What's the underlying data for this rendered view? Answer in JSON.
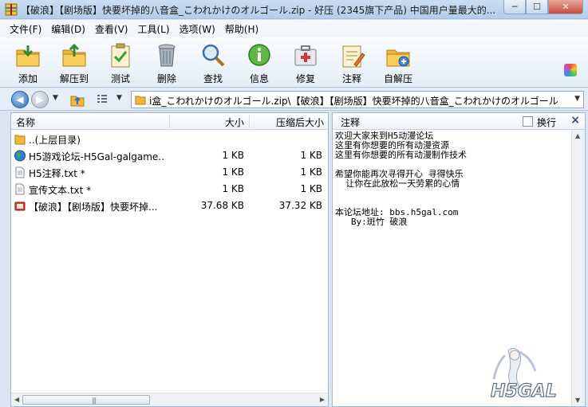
{
  "window": {
    "title": "【破浪】【剧场版】快要坏掉的八音盒_こわれかけのオルゴール.zip - 好压 (2345旗下产品) 中国用户量最大的...",
    "min_glyph": "─",
    "max_glyph": "☐",
    "close_glyph": "✕"
  },
  "menu": [
    {
      "label": "文件(F)"
    },
    {
      "label": "编辑(D)"
    },
    {
      "label": "查看(V)"
    },
    {
      "label": "工具(L)"
    },
    {
      "label": "选项(W)"
    },
    {
      "label": "帮助(H)"
    }
  ],
  "toolbar": [
    {
      "label": "添加",
      "icon": "add-icon"
    },
    {
      "label": "解压到",
      "icon": "extract-icon"
    },
    {
      "label": "测试",
      "icon": "test-icon"
    },
    {
      "label": "删除",
      "icon": "delete-icon"
    },
    {
      "label": "查找",
      "icon": "search-icon"
    },
    {
      "label": "信息",
      "icon": "info-icon"
    },
    {
      "label": "修复",
      "icon": "repair-icon"
    },
    {
      "label": "注释",
      "icon": "comment-icon"
    },
    {
      "label": "自解压",
      "icon": "sfx-icon"
    }
  ],
  "address": {
    "path": "i盒_こわれかけのオルゴール.zip\\【破浪】【剧场版】快要坏掉的八音盒_こわれかけのオルゴール"
  },
  "columns": {
    "name": "名称",
    "size": "大小",
    "packed": "压缩后大小"
  },
  "files": [
    {
      "name": "..(上层目录)",
      "size": "",
      "packed": "",
      "icon": "folder-up-icon"
    },
    {
      "name": "H5游戏论坛-H5Gal-galgame...",
      "size": "1 KB",
      "packed": "1 KB",
      "icon": "globe-icon"
    },
    {
      "name": "H5注释.txt *",
      "size": "1 KB",
      "packed": "1 KB",
      "icon": "text-file-icon"
    },
    {
      "name": "宣传文本.txt *",
      "size": "1 KB",
      "packed": "1 KB",
      "icon": "text-file-icon"
    },
    {
      "name": "【破浪】【剧场版】快要坏掉...",
      "size": "37.68 KB",
      "packed": "37.32 KB",
      "icon": "video-file-icon"
    }
  ],
  "comment": {
    "title": "注释",
    "wrap_label": "换行",
    "lines": [
      "欢迎大家来到H5动漫论坛",
      "这里有你想要的所有动漫资源",
      "这里有你想要的所有动漫制作技术",
      "",
      "希望你能再次寻得开心 寻得快乐",
      "  让你在此放松一天劳累的心情",
      "",
      "",
      "本论坛地址: bbs.h5gal.com",
      "   By:斑竹 破浪"
    ]
  },
  "logo_text": "H5GAL"
}
